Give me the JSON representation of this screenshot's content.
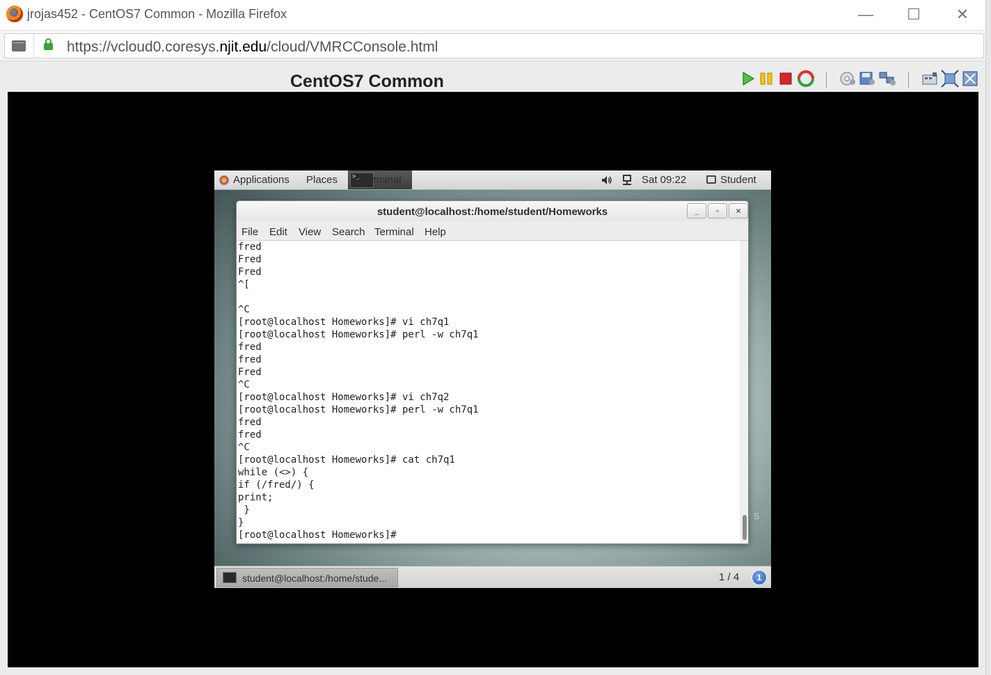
{
  "window": {
    "title": "jrojas452 - CentOS7 Common - Mozilla Firefox",
    "minimize": "—",
    "maximize": "☐",
    "close": "✕"
  },
  "urlbar": {
    "url_prefix": "https://vcloud0.coresys.",
    "url_domain": "njit.edu",
    "url_suffix": "/cloud/VMRCConsole.html"
  },
  "vmrc": {
    "title": "CentOS7 Common",
    "toolbar_icons": [
      "play-icon",
      "pause-icon",
      "stop-icon",
      "reset-icon",
      "cd-icon",
      "floppy-icon",
      "network-icon",
      "ctrl-alt-del-icon",
      "fit-window-icon",
      "fullscreen-icon"
    ]
  },
  "guest": {
    "topbar": {
      "applications": "Applications",
      "places": "Places",
      "terminal": "Terminal",
      "clock": "Sat 09:22",
      "user": "Student"
    },
    "terminal": {
      "title": "student@localhost:/home/student/Homeworks",
      "menu": [
        "File",
        "Edit",
        "View",
        "Search",
        "Terminal",
        "Help"
      ],
      "lines": [
        "fred",
        "Fred",
        "Fred",
        "^[",
        "",
        "^C",
        "[root@localhost Homeworks]# vi ch7q1",
        "[root@localhost Homeworks]# perl -w ch7q1",
        "fred",
        "fred",
        "Fred",
        "^C",
        "[root@localhost Homeworks]# vi ch7q2",
        "[root@localhost Homeworks]# perl -w ch7q1",
        "fred",
        "fred",
        "^C",
        "[root@localhost Homeworks]# cat ch7q1",
        "while (<>) {",
        "if (/fred/) {",
        "print;",
        " }",
        "}",
        "[root@localhost Homeworks]# "
      ]
    },
    "bottombar": {
      "task": "student@localhost:/home/stude...",
      "workspace": "1 / 4",
      "notifications": "1"
    }
  }
}
